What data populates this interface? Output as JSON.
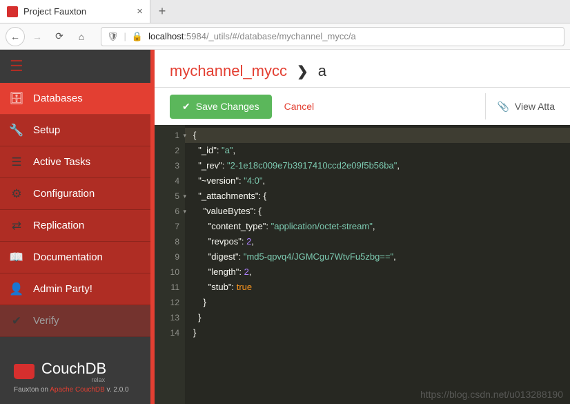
{
  "browser": {
    "tab_title": "Project Fauxton",
    "url_host": "localhost",
    "url_path": ":5984/_utils/#/database/mychannel_mycc/a"
  },
  "sidebar": {
    "items": [
      {
        "label": "Databases",
        "icon": "database-icon",
        "active": true
      },
      {
        "label": "Setup",
        "icon": "wrench-icon"
      },
      {
        "label": "Active Tasks",
        "icon": "tasks-icon"
      },
      {
        "label": "Configuration",
        "icon": "gear-icon"
      },
      {
        "label": "Replication",
        "icon": "replication-icon"
      },
      {
        "label": "Documentation",
        "icon": "book-icon"
      },
      {
        "label": "Admin Party!",
        "icon": "user-icon"
      },
      {
        "label": "Verify",
        "icon": "check-icon"
      }
    ],
    "logo_text": "CouchDB",
    "logo_sub": "relax",
    "footer_prefix": "Fauxton on ",
    "footer_link": "Apache CouchDB",
    "footer_version": " v. 2.0.0"
  },
  "breadcrumb": {
    "db": "mychannel_mycc",
    "doc": "a"
  },
  "toolbar": {
    "save_label": "Save Changes",
    "cancel_label": "Cancel",
    "view_attachments_label": "View Atta"
  },
  "document": {
    "_id": "a",
    "_rev": "2-1e18c009e7b3917410ccd2e09f5b56ba",
    "~version": "4:0",
    "_attachments": {
      "valueBytes": {
        "content_type": "application/octet-stream",
        "revpos": 2,
        "digest": "md5-qpvq4/JGMCgu7WtvFu5zbg==",
        "length": 2,
        "stub": true
      }
    }
  },
  "editor_lines": [
    1,
    2,
    3,
    4,
    5,
    6,
    7,
    8,
    9,
    10,
    11,
    12,
    13,
    14
  ],
  "watermark": "https://blog.csdn.net/u013288190"
}
